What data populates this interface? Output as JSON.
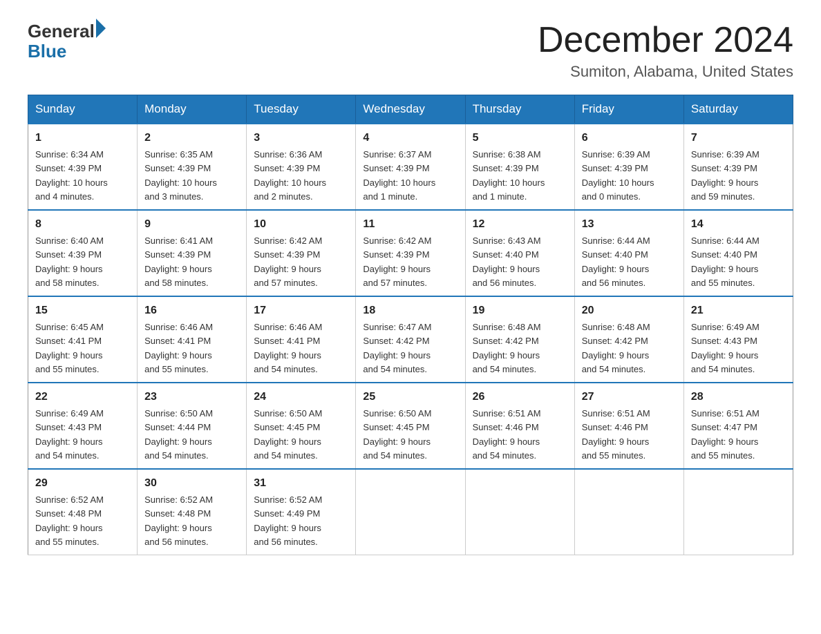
{
  "logo": {
    "text_general": "General",
    "triangle": "▶",
    "text_blue": "Blue"
  },
  "title": "December 2024",
  "subtitle": "Sumiton, Alabama, United States",
  "days_of_week": [
    "Sunday",
    "Monday",
    "Tuesday",
    "Wednesday",
    "Thursday",
    "Friday",
    "Saturday"
  ],
  "weeks": [
    [
      {
        "day": "1",
        "sunrise": "6:34 AM",
        "sunset": "4:39 PM",
        "daylight": "10 hours and 4 minutes."
      },
      {
        "day": "2",
        "sunrise": "6:35 AM",
        "sunset": "4:39 PM",
        "daylight": "10 hours and 3 minutes."
      },
      {
        "day": "3",
        "sunrise": "6:36 AM",
        "sunset": "4:39 PM",
        "daylight": "10 hours and 2 minutes."
      },
      {
        "day": "4",
        "sunrise": "6:37 AM",
        "sunset": "4:39 PM",
        "daylight": "10 hours and 1 minute."
      },
      {
        "day": "5",
        "sunrise": "6:38 AM",
        "sunset": "4:39 PM",
        "daylight": "10 hours and 1 minute."
      },
      {
        "day": "6",
        "sunrise": "6:39 AM",
        "sunset": "4:39 PM",
        "daylight": "10 hours and 0 minutes."
      },
      {
        "day": "7",
        "sunrise": "6:39 AM",
        "sunset": "4:39 PM",
        "daylight": "9 hours and 59 minutes."
      }
    ],
    [
      {
        "day": "8",
        "sunrise": "6:40 AM",
        "sunset": "4:39 PM",
        "daylight": "9 hours and 58 minutes."
      },
      {
        "day": "9",
        "sunrise": "6:41 AM",
        "sunset": "4:39 PM",
        "daylight": "9 hours and 58 minutes."
      },
      {
        "day": "10",
        "sunrise": "6:42 AM",
        "sunset": "4:39 PM",
        "daylight": "9 hours and 57 minutes."
      },
      {
        "day": "11",
        "sunrise": "6:42 AM",
        "sunset": "4:39 PM",
        "daylight": "9 hours and 57 minutes."
      },
      {
        "day": "12",
        "sunrise": "6:43 AM",
        "sunset": "4:40 PM",
        "daylight": "9 hours and 56 minutes."
      },
      {
        "day": "13",
        "sunrise": "6:44 AM",
        "sunset": "4:40 PM",
        "daylight": "9 hours and 56 minutes."
      },
      {
        "day": "14",
        "sunrise": "6:44 AM",
        "sunset": "4:40 PM",
        "daylight": "9 hours and 55 minutes."
      }
    ],
    [
      {
        "day": "15",
        "sunrise": "6:45 AM",
        "sunset": "4:41 PM",
        "daylight": "9 hours and 55 minutes."
      },
      {
        "day": "16",
        "sunrise": "6:46 AM",
        "sunset": "4:41 PM",
        "daylight": "9 hours and 55 minutes."
      },
      {
        "day": "17",
        "sunrise": "6:46 AM",
        "sunset": "4:41 PM",
        "daylight": "9 hours and 54 minutes."
      },
      {
        "day": "18",
        "sunrise": "6:47 AM",
        "sunset": "4:42 PM",
        "daylight": "9 hours and 54 minutes."
      },
      {
        "day": "19",
        "sunrise": "6:48 AM",
        "sunset": "4:42 PM",
        "daylight": "9 hours and 54 minutes."
      },
      {
        "day": "20",
        "sunrise": "6:48 AM",
        "sunset": "4:42 PM",
        "daylight": "9 hours and 54 minutes."
      },
      {
        "day": "21",
        "sunrise": "6:49 AM",
        "sunset": "4:43 PM",
        "daylight": "9 hours and 54 minutes."
      }
    ],
    [
      {
        "day": "22",
        "sunrise": "6:49 AM",
        "sunset": "4:43 PM",
        "daylight": "9 hours and 54 minutes."
      },
      {
        "day": "23",
        "sunrise": "6:50 AM",
        "sunset": "4:44 PM",
        "daylight": "9 hours and 54 minutes."
      },
      {
        "day": "24",
        "sunrise": "6:50 AM",
        "sunset": "4:45 PM",
        "daylight": "9 hours and 54 minutes."
      },
      {
        "day": "25",
        "sunrise": "6:50 AM",
        "sunset": "4:45 PM",
        "daylight": "9 hours and 54 minutes."
      },
      {
        "day": "26",
        "sunrise": "6:51 AM",
        "sunset": "4:46 PM",
        "daylight": "9 hours and 54 minutes."
      },
      {
        "day": "27",
        "sunrise": "6:51 AM",
        "sunset": "4:46 PM",
        "daylight": "9 hours and 55 minutes."
      },
      {
        "day": "28",
        "sunrise": "6:51 AM",
        "sunset": "4:47 PM",
        "daylight": "9 hours and 55 minutes."
      }
    ],
    [
      {
        "day": "29",
        "sunrise": "6:52 AM",
        "sunset": "4:48 PM",
        "daylight": "9 hours and 55 minutes."
      },
      {
        "day": "30",
        "sunrise": "6:52 AM",
        "sunset": "4:48 PM",
        "daylight": "9 hours and 56 minutes."
      },
      {
        "day": "31",
        "sunrise": "6:52 AM",
        "sunset": "4:49 PM",
        "daylight": "9 hours and 56 minutes."
      },
      null,
      null,
      null,
      null
    ]
  ],
  "labels": {
    "sunrise": "Sunrise:",
    "sunset": "Sunset:",
    "daylight": "Daylight:"
  }
}
